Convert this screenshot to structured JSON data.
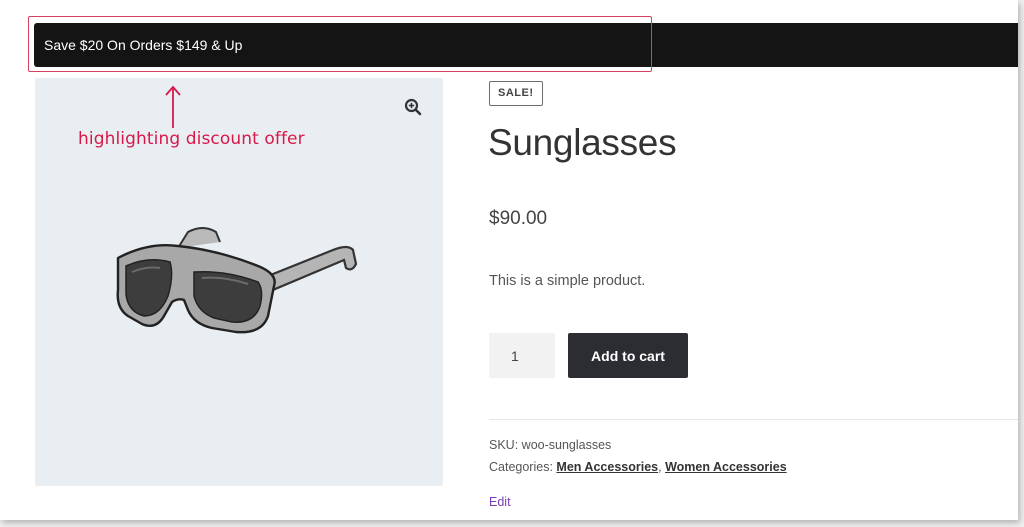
{
  "store_notice": {
    "text": "Save $20 On Orders $149 & Up"
  },
  "annotation": {
    "text": "highlighting discount offer",
    "color": "#d7194a"
  },
  "product": {
    "image_alt": "sunglasses-image",
    "sale_badge": "SALE!",
    "title": "Sunglasses",
    "price": "$90.00",
    "short_description": "This is a simple product.",
    "quantity": "1",
    "add_to_cart_label": "Add to cart",
    "sku_label": "SKU:",
    "sku_value": "woo-sunglasses",
    "categories_label": "Categories:",
    "categories": [
      "Men Accessories",
      "Women Accessories"
    ],
    "edit_label": "Edit"
  },
  "icons": {
    "zoom": "zoom-in-icon",
    "arrow": "arrow-up-icon"
  },
  "colors": {
    "notice_bg": "#141414",
    "button_bg": "#2c2d33",
    "image_bg": "#e9eef2",
    "highlight": "#d9405f",
    "edit_link": "#7a3fb8"
  }
}
